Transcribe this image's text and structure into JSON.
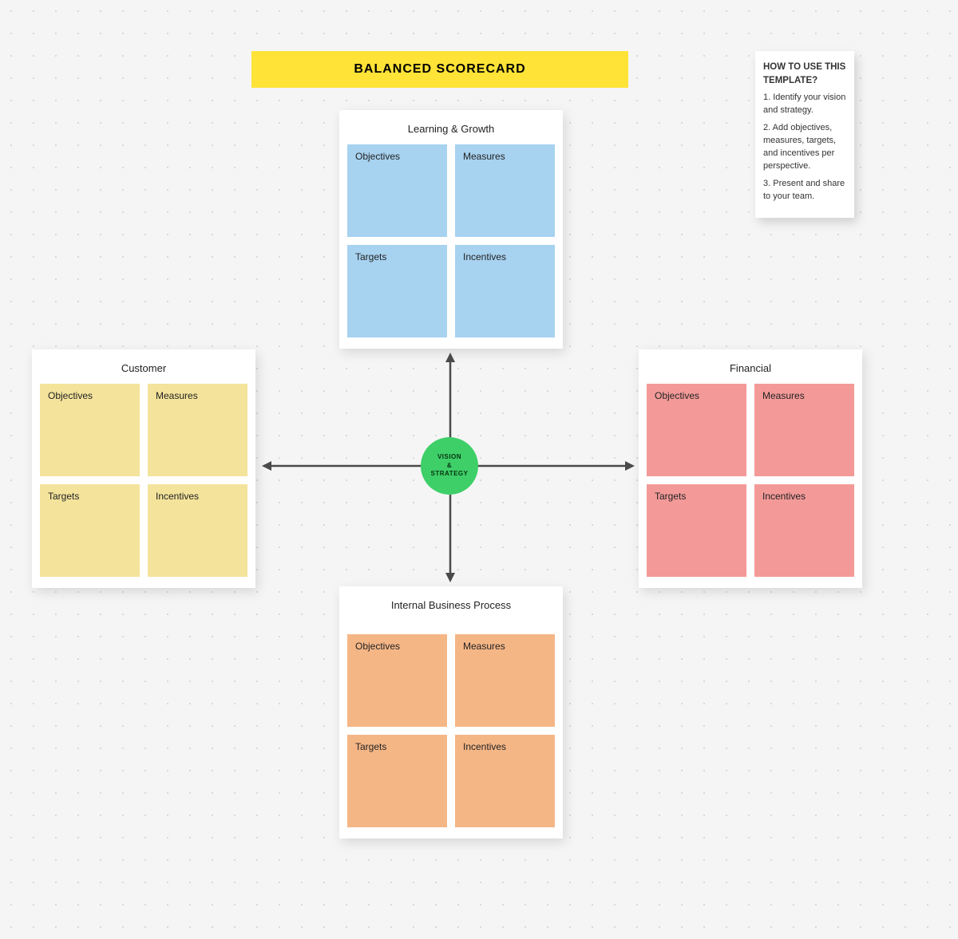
{
  "title": "BALANCED SCORECARD",
  "center": "VISION\n&\nSTRATEGY",
  "help": {
    "title": "HOW TO USE THIS TEMPLATE?",
    "steps": [
      "1. Identify your vision and strategy.",
      "2. Add objectives, measures, targets, and incentives per perspective.",
      "3. Present and share to your team."
    ]
  },
  "panels": {
    "top": {
      "title": "Learning & Growth",
      "cells": [
        "Objectives",
        "Measures",
        "Targets",
        "Incentives"
      ]
    },
    "left": {
      "title": "Customer",
      "cells": [
        "Objectives",
        "Measures",
        "Targets",
        "Incentives"
      ]
    },
    "right": {
      "title": "Financial",
      "cells": [
        "Objectives",
        "Measures",
        "Targets",
        "Incentives"
      ]
    },
    "bottom": {
      "title": "Internal Business Process",
      "cells": [
        "Objectives",
        "Measures",
        "Targets",
        "Incentives"
      ]
    }
  },
  "colors": {
    "title_bg": "#ffe337",
    "center_bg": "#3ecf68",
    "top_cell": "#a7d2f0",
    "left_cell": "#f4e39b",
    "right_cell": "#f39a98",
    "bottom_cell": "#f5b686",
    "arrow": "#4a4a4a"
  }
}
